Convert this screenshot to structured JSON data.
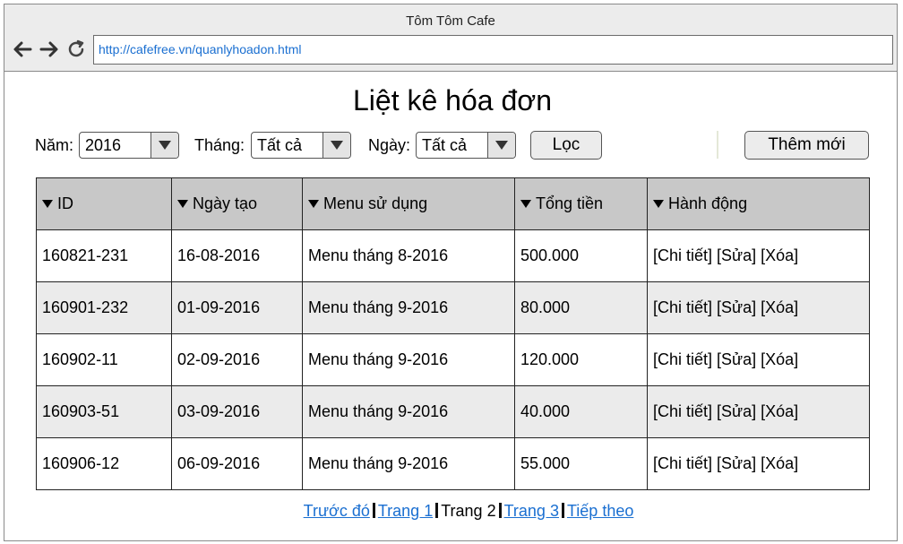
{
  "window": {
    "title": "Tôm Tôm Cafe",
    "url": "http://cafefree.vn/quanlyhoadon.html"
  },
  "page": {
    "title": "Liệt kê hóa đơn"
  },
  "filters": {
    "year_label": "Năm:",
    "year_value": "2016",
    "month_label": "Tháng:",
    "month_value": "Tất cả",
    "day_label": "Ngày:",
    "day_value": "Tất cả",
    "filter_button": "Lọc",
    "add_button": "Thêm mới"
  },
  "table": {
    "columns": [
      "ID",
      "Ngày tạo",
      "Menu sử dụng",
      "Tổng tiền",
      "Hành động"
    ],
    "rows": [
      {
        "id": "160821-231",
        "date": "16-08-2016",
        "menu": "Menu tháng 8-2016",
        "total": "500.000"
      },
      {
        "id": "160901-232",
        "date": "01-09-2016",
        "menu": "Menu tháng 9-2016",
        "total": "80.000"
      },
      {
        "id": "160902-11",
        "date": "02-09-2016",
        "menu": "Menu tháng 9-2016",
        "total": "120.000"
      },
      {
        "id": "160903-51",
        "date": "03-09-2016",
        "menu": "Menu tháng 9-2016",
        "total": "40.000"
      },
      {
        "id": "160906-12",
        "date": "06-09-2016",
        "menu": "Menu tháng 9-2016",
        "total": "55.000"
      }
    ],
    "actions": {
      "detail": "[Chi tiết]",
      "edit": "[Sửa]",
      "delete": "[Xóa]"
    }
  },
  "pagination": {
    "prev": "Trước đó",
    "page1": "Trang 1",
    "current": "Trang 2",
    "page3": "Trang 3",
    "next": "Tiếp theo"
  }
}
